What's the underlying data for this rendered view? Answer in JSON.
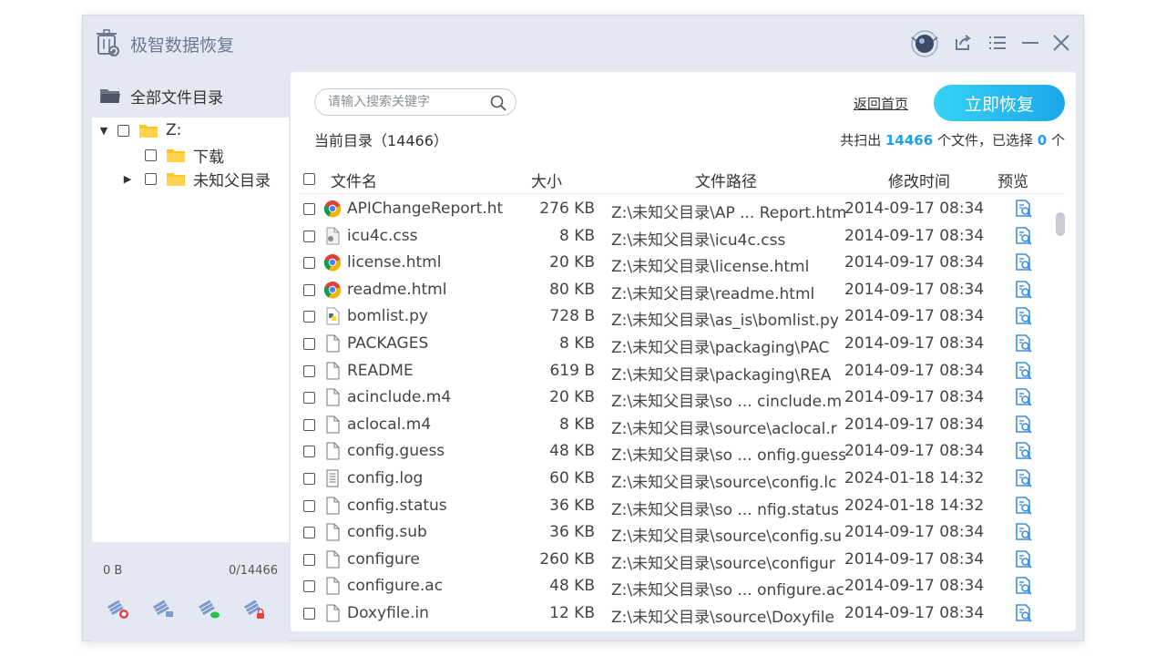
{
  "app": {
    "title": "极智数据恢复"
  },
  "sidebar": {
    "header_label": "全部文件目录",
    "tree": [
      {
        "label": "Z:",
        "level": 0,
        "caret": "expanded"
      },
      {
        "label": "下载",
        "level": 1,
        "caret": "none"
      },
      {
        "label": "未知父目录",
        "level": 1,
        "caret": "collapsed"
      }
    ],
    "footer": {
      "size": "0 B",
      "count": "0/14466"
    }
  },
  "search": {
    "placeholder": "请输入搜索关键字"
  },
  "toolbar": {
    "home_link": "返回首页",
    "recover_label": "立即恢复"
  },
  "current_dir": "当前目录（14466）",
  "scan_info": {
    "prefix": "共扫出",
    "total": "14466",
    "mid": "个文件，已选择",
    "selected": "0",
    "suffix": "个"
  },
  "table": {
    "columns": [
      "文件名",
      "大小",
      "文件路径",
      "修改时间",
      "预览"
    ],
    "rows": [
      {
        "icon": "chrome-icon",
        "name": "APIChangeReport.ht",
        "size": "276 KB",
        "path": "Z:\\未知父目录\\AP ... Report.htm",
        "time": "2014-09-17 08:34"
      },
      {
        "icon": "css-file-icon",
        "name": "icu4c.css",
        "size": "8 KB",
        "path": "Z:\\未知父目录\\icu4c.css",
        "time": "2014-09-17 08:34"
      },
      {
        "icon": "chrome-icon",
        "name": "license.html",
        "size": "20 KB",
        "path": "Z:\\未知父目录\\license.html",
        "time": "2014-09-17 08:34"
      },
      {
        "icon": "chrome-icon",
        "name": "readme.html",
        "size": "80 KB",
        "path": "Z:\\未知父目录\\readme.html",
        "time": "2014-09-17 08:34"
      },
      {
        "icon": "python-file-icon",
        "name": "bomlist.py",
        "size": "728 B",
        "path": "Z:\\未知父目录\\as_is\\bomlist.py",
        "time": "2014-09-17 08:34"
      },
      {
        "icon": "file-icon",
        "name": "PACKAGES",
        "size": "8 KB",
        "path": "Z:\\未知父目录\\packaging\\PAC",
        "time": "2014-09-17 08:34"
      },
      {
        "icon": "file-icon",
        "name": "README",
        "size": "619 B",
        "path": "Z:\\未知父目录\\packaging\\REA",
        "time": "2014-09-17 08:34"
      },
      {
        "icon": "file-icon",
        "name": "acinclude.m4",
        "size": "20 KB",
        "path": "Z:\\未知父目录\\so ... cinclude.m",
        "time": "2014-09-17 08:34"
      },
      {
        "icon": "file-icon",
        "name": "aclocal.m4",
        "size": "8 KB",
        "path": "Z:\\未知父目录\\source\\aclocal.r",
        "time": "2014-09-17 08:34"
      },
      {
        "icon": "file-icon",
        "name": "config.guess",
        "size": "48 KB",
        "path": "Z:\\未知父目录\\so ... onfig.guess",
        "time": "2014-09-17 08:34"
      },
      {
        "icon": "text-file-icon",
        "name": "config.log",
        "size": "60 KB",
        "path": "Z:\\未知父目录\\source\\config.lc",
        "time": "2024-01-18 14:32"
      },
      {
        "icon": "file-icon",
        "name": "config.status",
        "size": "36 KB",
        "path": "Z:\\未知父目录\\so ... nfig.status",
        "time": "2024-01-18 14:32"
      },
      {
        "icon": "file-icon",
        "name": "config.sub",
        "size": "36 KB",
        "path": "Z:\\未知父目录\\source\\config.su",
        "time": "2014-09-17 08:34"
      },
      {
        "icon": "file-icon",
        "name": "configure",
        "size": "260 KB",
        "path": "Z:\\未知父目录\\source\\configur",
        "time": "2014-09-17 08:34"
      },
      {
        "icon": "file-icon",
        "name": "configure.ac",
        "size": "48 KB",
        "path": "Z:\\未知父目录\\so ... onfigure.ac",
        "time": "2014-09-17 08:34"
      },
      {
        "icon": "file-icon",
        "name": "Doxyfile.in",
        "size": "12 KB",
        "path": "Z:\\未知父目录\\source\\Doxyfile",
        "time": "2014-09-17 08:34"
      }
    ]
  },
  "colors": {
    "accent": "#1ea0ee",
    "button_start": "#35d3f5",
    "button_end": "#1aa6ec",
    "window_bg": "#e3e8f2",
    "folder": "#ffc21f"
  }
}
